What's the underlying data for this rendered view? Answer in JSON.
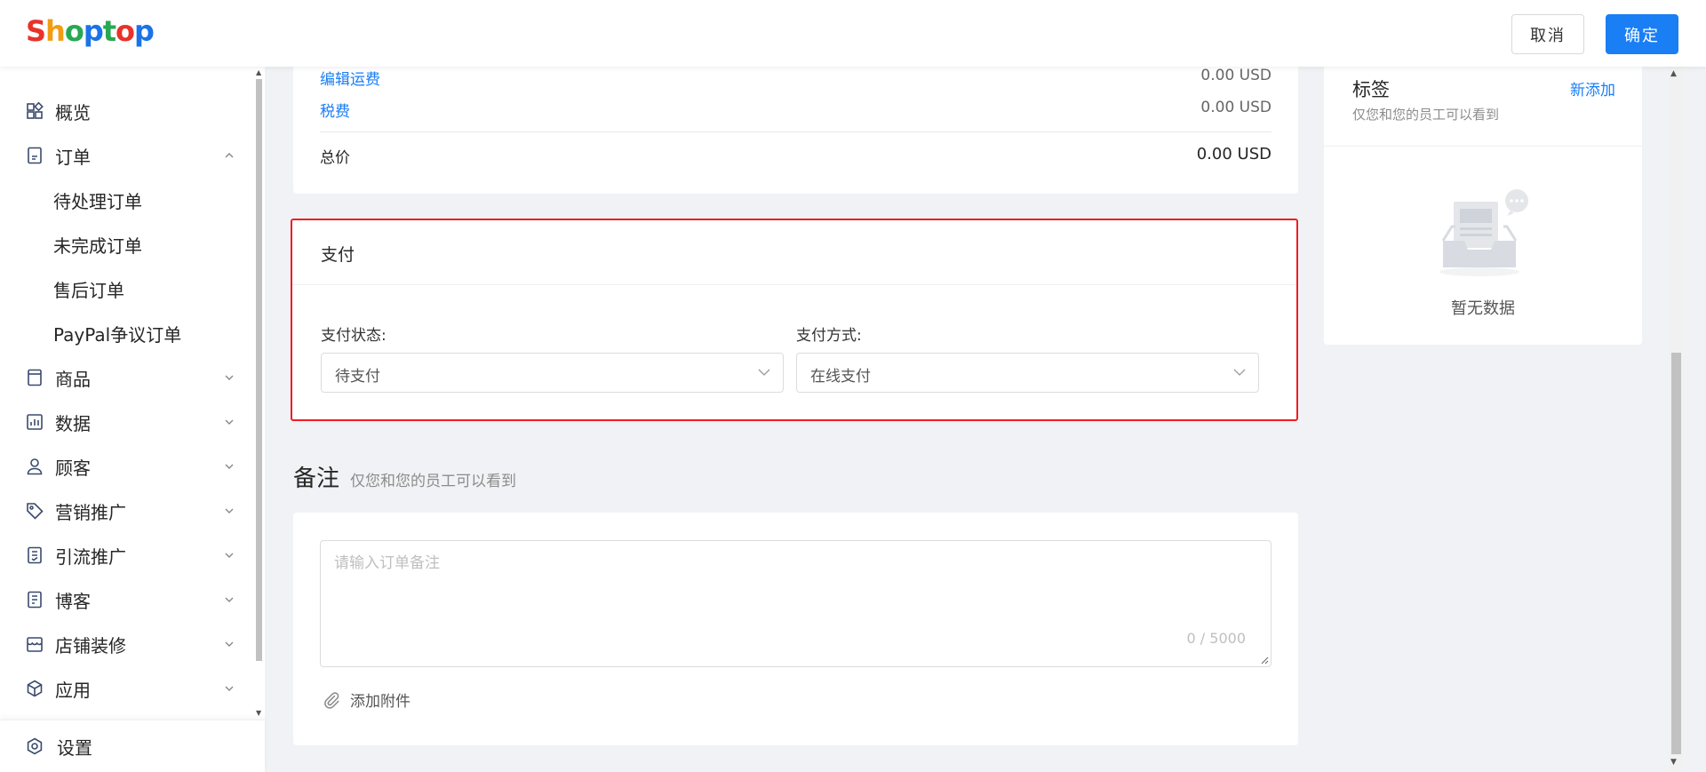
{
  "header": {
    "logo": [
      "S",
      "h",
      "o",
      "p",
      "t",
      "o",
      "p"
    ],
    "cancel_label": "取消",
    "confirm_label": "确定"
  },
  "sidebar": {
    "items": [
      {
        "label": "概览",
        "icon": "dashboard-icon"
      },
      {
        "label": "订单",
        "icon": "order-icon",
        "expanded": true
      },
      {
        "label": "待处理订单"
      },
      {
        "label": "未完成订单"
      },
      {
        "label": "售后订单"
      },
      {
        "label": "PayPal争议订单"
      },
      {
        "label": "商品",
        "icon": "product-icon"
      },
      {
        "label": "数据",
        "icon": "chart-icon"
      },
      {
        "label": "顾客",
        "icon": "user-icon"
      },
      {
        "label": "营销推广",
        "icon": "tag-icon"
      },
      {
        "label": "引流推广",
        "icon": "traffic-icon"
      },
      {
        "label": "博客",
        "icon": "blog-icon"
      },
      {
        "label": "店铺装修",
        "icon": "store-icon"
      },
      {
        "label": "应用",
        "icon": "app-icon"
      }
    ],
    "settings_label": "设置"
  },
  "summary": {
    "shipping_label": "编辑运费",
    "shipping_amount": "0.00 USD",
    "tax_label": "税费",
    "tax_amount": "0.00 USD",
    "total_label": "总价",
    "total_amount": "0.00 USD"
  },
  "payment": {
    "title": "支付",
    "status_label": "支付状态:",
    "status_value": "待支付",
    "method_label": "支付方式:",
    "method_value": "在线支付"
  },
  "notes": {
    "title": "备注",
    "subtitle": "仅您和您的员工可以看到",
    "placeholder": "请输入订单备注",
    "counter": "0 / 5000",
    "attach_label": "添加附件"
  },
  "tags": {
    "title": "标签",
    "add_label": "新添加",
    "subtitle": "仅您和您的员工可以看到",
    "empty_label": "暂无数据"
  },
  "colors": {
    "primary": "#1a7ef5",
    "highlight_border": "#ee1d23",
    "background": "#f1f2f5"
  }
}
